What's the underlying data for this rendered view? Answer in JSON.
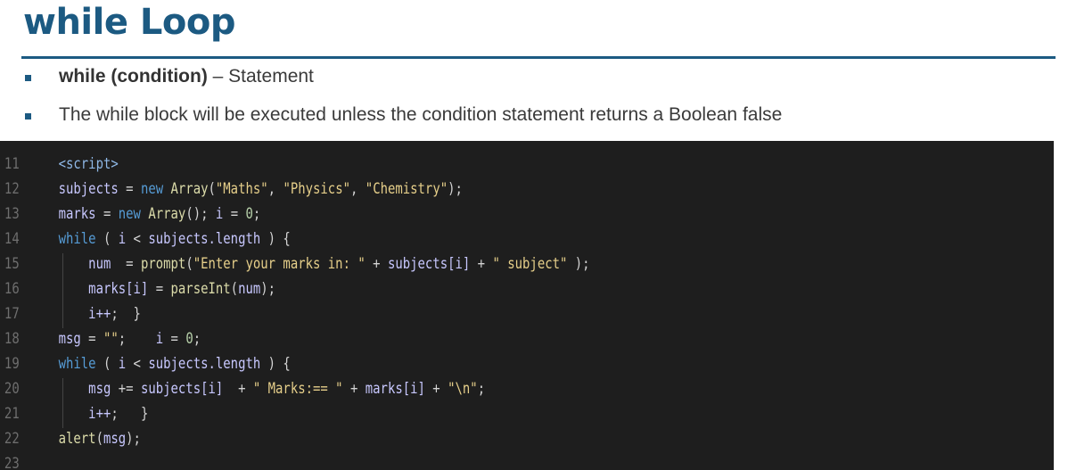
{
  "slide": {
    "title": "while Loop",
    "bullets": [
      {
        "bold": "while (condition)",
        "rest": " – Statement"
      },
      {
        "text": "The while block will be executed unless the condition statement returns a Boolean false"
      }
    ]
  },
  "code": {
    "line_numbers": [
      "11",
      "12",
      "13",
      "14",
      "15",
      "16",
      "17",
      "18",
      "19",
      "20",
      "21",
      "22",
      "23"
    ],
    "lines": [
      {
        "parts": [
          [
            "tag",
            "<script>"
          ]
        ]
      },
      {
        "parts": [
          [
            "id",
            "subjects"
          ],
          [
            "op",
            " = "
          ],
          [
            "kw",
            "new "
          ],
          [
            "fn",
            "Array"
          ],
          [
            "op",
            "("
          ],
          [
            "str",
            "\"Maths\""
          ],
          [
            "op",
            ", "
          ],
          [
            "str",
            "\"Physics\""
          ],
          [
            "op",
            ", "
          ],
          [
            "str",
            "\"Chemistry\""
          ],
          [
            "op",
            ");"
          ]
        ]
      },
      {
        "parts": [
          [
            "id",
            "marks"
          ],
          [
            "op",
            " = "
          ],
          [
            "kw",
            "new "
          ],
          [
            "fn",
            "Array"
          ],
          [
            "op",
            "(); "
          ],
          [
            "id",
            "i"
          ],
          [
            "op",
            " = "
          ],
          [
            "num",
            "0"
          ],
          [
            "op",
            ";"
          ]
        ]
      },
      {
        "parts": [
          [
            "kw",
            "while"
          ],
          [
            "op",
            " ( "
          ],
          [
            "id",
            "i"
          ],
          [
            "op",
            " < "
          ],
          [
            "id",
            "subjects.length"
          ],
          [
            "op",
            " ) {"
          ]
        ]
      },
      {
        "parts": [
          [
            "op",
            "    "
          ],
          [
            "id",
            "num"
          ],
          [
            "op",
            "  = "
          ],
          [
            "fn",
            "prompt"
          ],
          [
            "op",
            "("
          ],
          [
            "str",
            "\"Enter your marks in: \""
          ],
          [
            "op",
            " + "
          ],
          [
            "id",
            "subjects[i]"
          ],
          [
            "op",
            " + "
          ],
          [
            "str",
            "\" subject\""
          ],
          [
            "op",
            " );"
          ]
        ]
      },
      {
        "parts": [
          [
            "op",
            "    "
          ],
          [
            "id",
            "marks[i]"
          ],
          [
            "op",
            " = "
          ],
          [
            "fn",
            "parseInt"
          ],
          [
            "op",
            "("
          ],
          [
            "id",
            "num"
          ],
          [
            "op",
            ");"
          ]
        ]
      },
      {
        "parts": [
          [
            "op",
            "    "
          ],
          [
            "id",
            "i++"
          ],
          [
            "op",
            ";  }"
          ]
        ]
      },
      {
        "parts": [
          [
            "id",
            "msg"
          ],
          [
            "op",
            " = "
          ],
          [
            "str",
            "\"\""
          ],
          [
            "op",
            ";    "
          ],
          [
            "id",
            "i"
          ],
          [
            "op",
            " = "
          ],
          [
            "num",
            "0"
          ],
          [
            "op",
            ";"
          ]
        ]
      },
      {
        "parts": [
          [
            "kw",
            "while"
          ],
          [
            "op",
            " ( "
          ],
          [
            "id",
            "i"
          ],
          [
            "op",
            " < "
          ],
          [
            "id",
            "subjects.length"
          ],
          [
            "op",
            " ) {"
          ]
        ]
      },
      {
        "parts": [
          [
            "op",
            "    "
          ],
          [
            "id",
            "msg"
          ],
          [
            "op",
            " += "
          ],
          [
            "id",
            "subjects[i]"
          ],
          [
            "op",
            "  + "
          ],
          [
            "str",
            "\" Marks:== \""
          ],
          [
            "op",
            " + "
          ],
          [
            "id",
            "marks[i]"
          ],
          [
            "op",
            " + "
          ],
          [
            "str",
            "\"\\n\""
          ],
          [
            "op",
            ";"
          ]
        ]
      },
      {
        "parts": [
          [
            "op",
            "    "
          ],
          [
            "id",
            "i++"
          ],
          [
            "op",
            ";   }"
          ]
        ]
      },
      {
        "parts": [
          [
            "fn",
            "alert"
          ],
          [
            "op",
            "("
          ],
          [
            "id",
            "msg"
          ],
          [
            "op",
            ");"
          ]
        ]
      },
      {
        "parts": []
      }
    ]
  }
}
